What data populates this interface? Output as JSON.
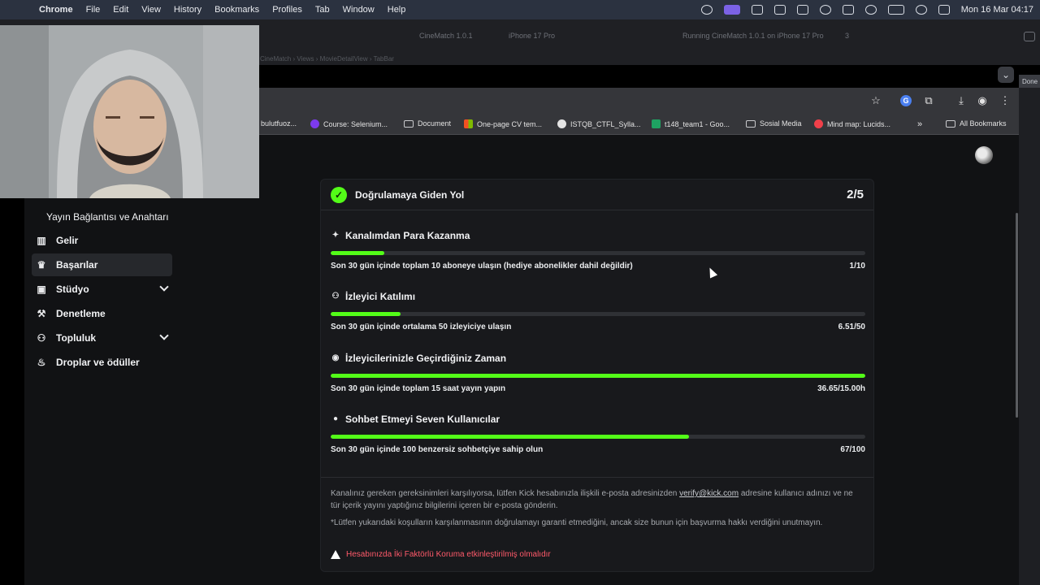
{
  "menubar": {
    "app": "Chrome",
    "items": [
      "File",
      "Edit",
      "View",
      "History",
      "Bookmarks",
      "Profiles",
      "Tab",
      "Window",
      "Help"
    ],
    "clock": "Mon 16 Mar  04:17"
  },
  "xcode": {
    "scheme": "CineMatch 1.0.1",
    "device": "iPhone 17 Pro",
    "status": "Running CineMatch 1.0.1 on iPhone 17 Pro",
    "warnings": "3",
    "breadcrumb": "CineMatch  ›  Views  ›  MovieDetailView  ›  TabBar",
    "done": "Done"
  },
  "bookmarks": {
    "items": [
      {
        "label": "bulutfuoz...",
        "icon": "generic"
      },
      {
        "label": "Course: Selenium...",
        "icon": "course-icon"
      },
      {
        "label": "Document",
        "icon": "folder-icon"
      },
      {
        "label": "One-page CV tem...",
        "icon": "microsoft-icon"
      },
      {
        "label": "ISTQB_CTFL_Sylla...",
        "icon": "globe-icon"
      },
      {
        "label": "t148_team1 - Goo...",
        "icon": "sheets-icon"
      },
      {
        "label": "Sosial Media",
        "icon": "folder-icon"
      },
      {
        "label": "Mind map: Lucids...",
        "icon": "lucid-icon"
      }
    ],
    "all": "All Bookmarks"
  },
  "sidebar": {
    "partial": "Yayın Bağlantısı ve Anahtarı",
    "items": [
      {
        "label": "Gelir",
        "icon": "chart-icon"
      },
      {
        "label": "Başarılar",
        "icon": "trophy-icon"
      },
      {
        "label": "Stüdyo",
        "icon": "studio-icon"
      },
      {
        "label": "Denetleme",
        "icon": "wrench-icon"
      },
      {
        "label": "Topluluk",
        "icon": "community-icon"
      },
      {
        "label": "Droplar ve ödüller",
        "icon": "cake-icon"
      }
    ]
  },
  "verification": {
    "title": "Doğrulamaya Giden Yol",
    "progress": "2/5",
    "requirements": [
      {
        "title": "Kanalımdan Para Kazanma",
        "description": "Son 30 gün içinde toplam 10 aboneye ulaşın (hediye abonelikler dahil değildir)",
        "value": "1/10",
        "fraction": 0.1,
        "icon": "sparkle-icon"
      },
      {
        "title": "İzleyici Katılımı",
        "description": "Son 30 gün içinde ortalama 50 izleyiciye ulaşın",
        "value": "6.51/50",
        "fraction": 0.13,
        "icon": "viewers-icon"
      },
      {
        "title": "İzleyicilerinizle Geçirdiğiniz Zaman",
        "description": "Son 30 gün içinde toplam 15 saat yayın yapın",
        "value": "36.65/15.00h",
        "fraction": 1.0,
        "icon": "broadcast-icon"
      },
      {
        "title": "Sohbet Etmeyi Seven Kullanıcılar",
        "description": "Son 30 gün içinde 100 benzersiz sohbetçiye sahip olun",
        "value": "67/100",
        "fraction": 0.67,
        "icon": "chat-icon"
      }
    ],
    "footer": {
      "text_before": "Kanalınız gereken gereksinimleri karşılıyorsa, lütfen Kick hesabınızla ilişkili e-posta adresinizden",
      "email": "verify@kick.com",
      "text_after": "adresine kullanıcı adınızı ve ne tür içerik yayını yaptığınız bilgilerini içeren bir e-posta gönderin.",
      "disclaimer": "*Lütfen yukarıdaki koşulların karşılanmasının doğrulamayı garanti etmediğini, ancak size bunun için başvurma hakkı verdiğini unutmayın.",
      "warning": "Hesabınızda İki Faktörlü Koruma etkinleştirilmiş olmalıdır"
    }
  },
  "colors": {
    "accent": "#53fc18",
    "warning": "#ff5a6a"
  }
}
